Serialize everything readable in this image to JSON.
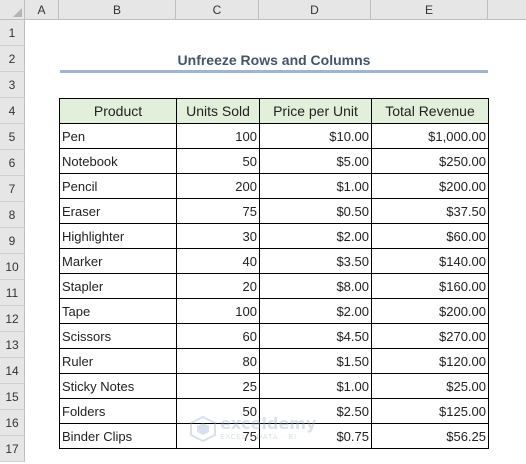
{
  "sheet": {
    "columns": [
      "A",
      "B",
      "C",
      "D",
      "E"
    ],
    "rows": [
      "1",
      "2",
      "3",
      "4",
      "5",
      "6",
      "7",
      "8",
      "9",
      "10",
      "11",
      "12",
      "13",
      "14",
      "15",
      "16",
      "17"
    ]
  },
  "title": "Unfreeze Rows and Columns",
  "table": {
    "headers": [
      "Product",
      "Units Sold",
      "Price per Unit",
      "Total Revenue"
    ],
    "rows": [
      [
        "Pen",
        "100",
        "$10.00",
        "$1,000.00"
      ],
      [
        "Notebook",
        "50",
        "$5.00",
        "$250.00"
      ],
      [
        "Pencil",
        "200",
        "$1.00",
        "$200.00"
      ],
      [
        "Eraser",
        "75",
        "$0.50",
        "$37.50"
      ],
      [
        "Highlighter",
        "30",
        "$2.00",
        "$60.00"
      ],
      [
        "Marker",
        "40",
        "$3.50",
        "$140.00"
      ],
      [
        "Stapler",
        "20",
        "$8.00",
        "$160.00"
      ],
      [
        "Tape",
        "100",
        "$2.00",
        "$200.00"
      ],
      [
        "Scissors",
        "60",
        "$4.50",
        "$270.00"
      ],
      [
        "Ruler",
        "80",
        "$1.50",
        "$120.00"
      ],
      [
        "Sticky Notes",
        "25",
        "$1.00",
        "$25.00"
      ],
      [
        "Folders",
        "50",
        "$2.50",
        "$125.00"
      ],
      [
        "Binder Clips",
        "75",
        "$0.75",
        "$56.25"
      ]
    ]
  },
  "watermark": {
    "name": "exceldemy",
    "tagline": "EXCEL · DATA · BI",
    "icon": "exceldemy-logo-icon"
  },
  "colors": {
    "header_fill": "#e2efda",
    "title_text": "#44546a",
    "title_underline": "#9fb4d6"
  }
}
